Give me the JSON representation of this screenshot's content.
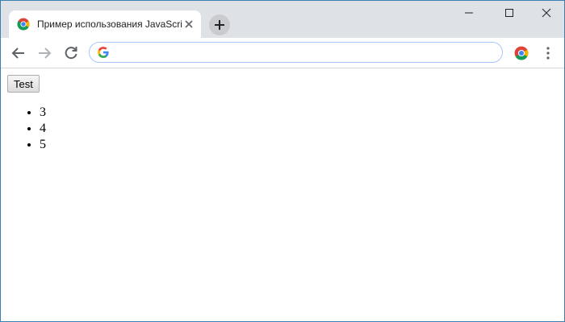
{
  "browser": {
    "tab": {
      "title": "Пример использования JavaScript"
    },
    "omnibox": {
      "value": "",
      "placeholder": ""
    }
  },
  "page": {
    "button_label": "Test",
    "list_items": [
      "3",
      "4",
      "5"
    ]
  },
  "icons": {
    "favicon": "chrome-icon",
    "tab_close": "close-icon",
    "new_tab": "plus-icon",
    "minimize": "minimize-icon",
    "maximize": "maximize-icon",
    "close": "close-icon",
    "back": "arrow-left-icon",
    "forward": "arrow-right-icon",
    "reload": "reload-icon",
    "search_provider": "google-icon",
    "extension": "chrome-icon",
    "menu": "kebab-menu-icon"
  },
  "colors": {
    "titlebar": "#dee1e6",
    "window_border": "#3c7fb1",
    "omnibox_border": "#a8c7fa"
  }
}
